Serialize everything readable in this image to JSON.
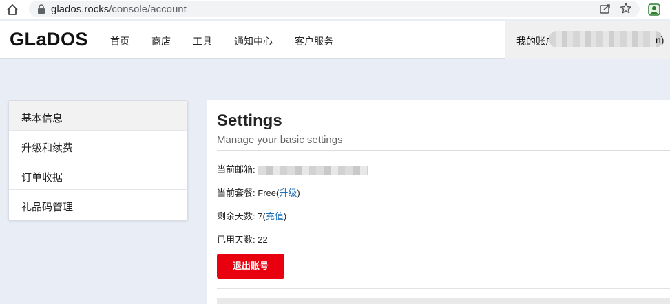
{
  "browser": {
    "url_host": "glados.rocks",
    "url_path": "/console/account"
  },
  "header": {
    "logo": "GLaDOS",
    "nav": [
      "首页",
      "商店",
      "工具",
      "通知中心",
      "客户服务"
    ],
    "account_label": "我的账户",
    "account_tail": "n)"
  },
  "sidebar": {
    "items": [
      {
        "label": "基本信息"
      },
      {
        "label": "升级和续费"
      },
      {
        "label": "订单收据"
      },
      {
        "label": "礼品码管理"
      }
    ]
  },
  "main": {
    "title": "Settings",
    "subtitle": "Manage your basic settings",
    "email_label": "当前邮箱:",
    "plan_label": "当前套餐:",
    "plan_value": "Free",
    "plan_link": "升级",
    "days_left_label": "剩余天数:",
    "days_left_value": "7",
    "recharge_link": "充值",
    "days_used_label": "已用天数:",
    "days_used_value": "22",
    "logout_label": "退出账号"
  },
  "colors": {
    "page_bg": "#e9edf5",
    "link": "#1a6fb5",
    "logout_button": "#e8000e"
  }
}
